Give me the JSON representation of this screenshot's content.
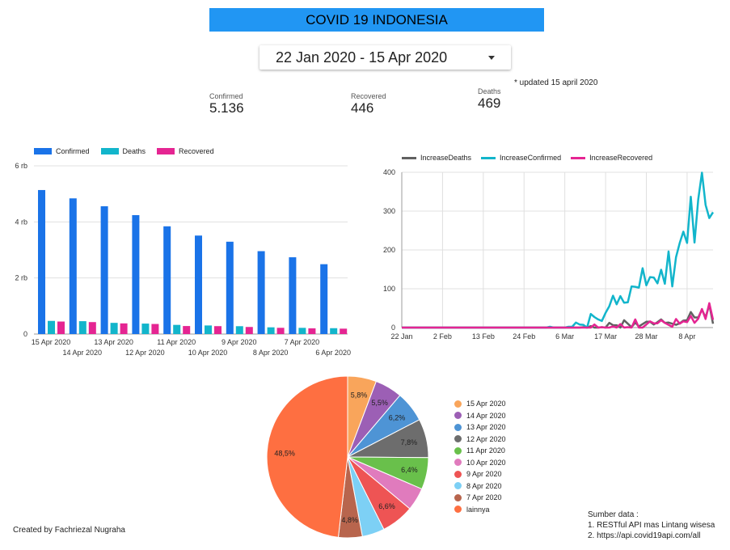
{
  "header": {
    "title": "COVID 19 INDONESIA"
  },
  "date_range": {
    "value": "22 Jan 2020 - 15 Apr 2020",
    "icon": "dropdown-caret-icon"
  },
  "kpis": {
    "confirmed": {
      "label": "Confirmed",
      "value": "5.136"
    },
    "recovered": {
      "label": "Recovered",
      "value": "446"
    },
    "deaths": {
      "label": "Deaths",
      "value": "469"
    }
  },
  "updated_note": "* updated 15 april 2020",
  "colors": {
    "title_bar": "#2196f3",
    "confirmed": "#1a73e8",
    "deaths": "#12b5cb",
    "recovered": "#e52592",
    "increase_deaths": "#616161",
    "increase_confirmed": "#12b5cb",
    "increase_recovered": "#e52592"
  },
  "chart_data": [
    {
      "type": "bar",
      "categories": [
        "15 Apr 2020",
        "14 Apr 2020",
        "13 Apr 2020",
        "12 Apr 2020",
        "11 Apr 2020",
        "10 Apr 2020",
        "9 Apr 2020",
        "8 Apr 2020",
        "7 Apr 2020",
        "6 Apr 2020"
      ],
      "series": [
        {
          "name": "Confirmed",
          "color": "#1a73e8",
          "values": [
            5136,
            4839,
            4557,
            4241,
            3842,
            3512,
            3293,
            2956,
            2738,
            2491
          ]
        },
        {
          "name": "Deaths",
          "color": "#12b5cb",
          "values": [
            469,
            459,
            399,
            373,
            327,
            306,
            280,
            240,
            221,
            209
          ]
        },
        {
          "name": "Recovered",
          "color": "#e52592",
          "values": [
            446,
            426,
            380,
            359,
            286,
            282,
            252,
            222,
            204,
            192
          ]
        }
      ],
      "y_ticks": [
        0,
        2000,
        4000,
        6000
      ],
      "y_tick_labels": [
        "0",
        "2 rb",
        "4 rb",
        "6 rb"
      ],
      "ylim": [
        0,
        6000
      ],
      "legend_position": "top-left",
      "grid": true
    },
    {
      "type": "line",
      "x": [
        "22 Jan",
        "23 Jan",
        "24 Jan",
        "25 Jan",
        "26 Jan",
        "27 Jan",
        "28 Jan",
        "29 Jan",
        "30 Jan",
        "31 Jan",
        "1 Feb",
        "2 Feb",
        "3 Feb",
        "4 Feb",
        "5 Feb",
        "6 Feb",
        "7 Feb",
        "8 Feb",
        "9 Feb",
        "10 Feb",
        "11 Feb",
        "12 Feb",
        "13 Feb",
        "14 Feb",
        "15 Feb",
        "16 Feb",
        "17 Feb",
        "18 Feb",
        "19 Feb",
        "20 Feb",
        "21 Feb",
        "22 Feb",
        "23 Feb",
        "24 Feb",
        "25 Feb",
        "26 Feb",
        "27 Feb",
        "28 Feb",
        "29 Feb",
        "1 Mar",
        "2 Mar",
        "3 Mar",
        "4 Mar",
        "5 Mar",
        "6 Mar",
        "7 Mar",
        "8 Mar",
        "9 Mar",
        "10 Mar",
        "11 Mar",
        "12 Mar",
        "13 Mar",
        "14 Mar",
        "15 Mar",
        "16 Mar",
        "17 Mar",
        "18 Mar",
        "19 Mar",
        "20 Mar",
        "21 Mar",
        "22 Mar",
        "23 Mar",
        "24 Mar",
        "25 Mar",
        "26 Mar",
        "27 Mar",
        "28 Mar",
        "29 Mar",
        "30 Mar",
        "31 Mar",
        "1 Apr",
        "2 Apr",
        "3 Apr",
        "4 Apr",
        "5 Apr",
        "6 Apr",
        "7 Apr",
        "8 Apr",
        "9 Apr",
        "10 Apr",
        "11 Apr",
        "12 Apr",
        "13 Apr",
        "14 Apr",
        "15 Apr"
      ],
      "x_tick_labels": [
        "22 Jan",
        "2 Feb",
        "13 Feb",
        "24 Feb",
        "6 Mar",
        "17 Mar",
        "28 Mar",
        "8 Apr"
      ],
      "series": [
        {
          "name": "IncreaseDeaths",
          "color": "#616161",
          "values": [
            0,
            0,
            0,
            0,
            0,
            0,
            0,
            0,
            0,
            0,
            0,
            0,
            0,
            0,
            0,
            0,
            0,
            0,
            0,
            0,
            0,
            0,
            0,
            0,
            0,
            0,
            0,
            0,
            0,
            0,
            0,
            0,
            0,
            0,
            0,
            0,
            0,
            0,
            0,
            0,
            0,
            0,
            0,
            0,
            0,
            0,
            0,
            0,
            0,
            1,
            0,
            4,
            0,
            0,
            1,
            0,
            12,
            6,
            6,
            0,
            19,
            10,
            1,
            13,
            3,
            9,
            15,
            15,
            8,
            14,
            21,
            12,
            13,
            10,
            7,
            11,
            18,
            19,
            40,
            26,
            26,
            46,
            26,
            59,
            10
          ]
        },
        {
          "name": "IncreaseConfirmed",
          "color": "#12b5cb",
          "values": [
            0,
            0,
            0,
            0,
            0,
            0,
            0,
            0,
            0,
            0,
            0,
            0,
            0,
            0,
            0,
            0,
            0,
            0,
            0,
            0,
            0,
            0,
            0,
            0,
            0,
            0,
            0,
            0,
            0,
            0,
            0,
            0,
            0,
            0,
            0,
            0,
            0,
            0,
            0,
            0,
            2,
            0,
            0,
            0,
            0,
            2,
            2,
            13,
            8,
            7,
            0,
            35,
            27,
            21,
            17,
            38,
            55,
            82,
            60,
            81,
            64,
            65,
            106,
            105,
            103,
            153,
            109,
            130,
            129,
            114,
            149,
            113,
            196,
            106,
            181,
            218,
            247,
            218,
            337,
            219,
            330,
            399,
            316,
            282,
            297
          ]
        },
        {
          "name": "IncreaseRecovered",
          "color": "#e52592",
          "values": [
            0,
            0,
            0,
            0,
            0,
            0,
            0,
            0,
            0,
            0,
            0,
            0,
            0,
            0,
            0,
            0,
            0,
            0,
            0,
            0,
            0,
            0,
            0,
            0,
            0,
            0,
            0,
            0,
            0,
            0,
            0,
            0,
            0,
            0,
            0,
            0,
            0,
            0,
            0,
            0,
            0,
            0,
            0,
            0,
            0,
            0,
            0,
            0,
            0,
            0,
            0,
            0,
            8,
            0,
            1,
            0,
            0,
            3,
            0,
            9,
            0,
            1,
            0,
            21,
            0,
            0,
            8,
            16,
            11,
            11,
            19,
            12,
            7,
            2,
            22,
            10,
            16,
            14,
            30,
            12,
            23,
            48,
            22,
            63,
            20
          ]
        }
      ],
      "y_ticks": [
        0,
        100,
        200,
        300,
        400
      ],
      "ylim": [
        0,
        400
      ],
      "legend_position": "top",
      "grid": true
    },
    {
      "type": "pie",
      "labels": [
        "15 Apr 2020",
        "14 Apr 2020",
        "13 Apr 2020",
        "12 Apr 2020",
        "11 Apr 2020",
        "10 Apr 2020",
        "9 Apr 2020",
        "8 Apr 2020",
        "7 Apr 2020",
        "lainnya"
      ],
      "values": [
        5.8,
        5.5,
        6.2,
        7.8,
        6.4,
        4.6,
        6.6,
        4.5,
        4.8,
        48.5
      ],
      "value_labels": [
        "5,8%",
        "5,5%",
        "6,2%",
        "7,8%",
        "6,4%",
        "",
        "6,6%",
        "",
        "4,8%",
        "48,5%"
      ],
      "colors": [
        "#f9a55b",
        "#9c5fb5",
        "#4e94d5",
        "#6d6d6d",
        "#69c04b",
        "#e07bbd",
        "#ee5454",
        "#7dd0f5",
        "#b8654d",
        "#fe6f41"
      ],
      "legend_position": "right"
    }
  ],
  "legend_icons": {
    "bar": "swatch-icon",
    "line": "line-swatch-icon",
    "pie": "dot-icon"
  },
  "footer": {
    "credit": "Created by Fachriezal Nugraha",
    "source_title": "Sumber data :",
    "source_1": "1. RESTful API mas Lintang wisesa",
    "source_2": "2. https://api.covid19api.com/all"
  }
}
